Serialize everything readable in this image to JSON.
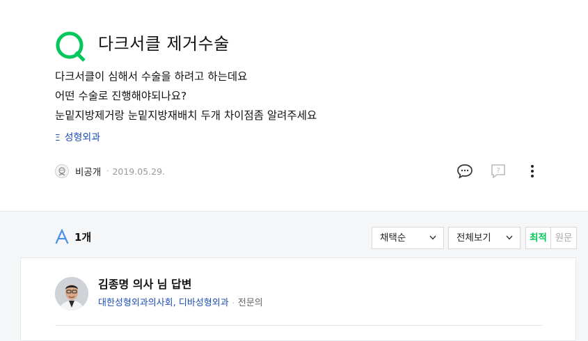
{
  "question": {
    "title": "다크서클 제거수술",
    "body_lines": [
      "다크서클이 심해서 수술을 하려고 하는데요",
      "어떤 수술로 진행해야되나요?",
      "눈밑지방제거랑 눈밑지방재배치 두개 차이점좀 알려주세요"
    ],
    "tag": "성형외과",
    "author": "비공개",
    "date": "2019.05.29.",
    "icons": [
      "comment-icon",
      "report-icon",
      "more-icon"
    ],
    "accent_color": "#03c75a"
  },
  "answers": {
    "count_label": "1개",
    "filter_sort": "채택순",
    "filter_view": "전체보기",
    "sort_options": [
      "최적",
      "원문"
    ],
    "answer": {
      "name": "김종명 의사 님 답변",
      "organization": "대한성형외과의사회, 디바성형외과",
      "role": "전문의"
    }
  }
}
